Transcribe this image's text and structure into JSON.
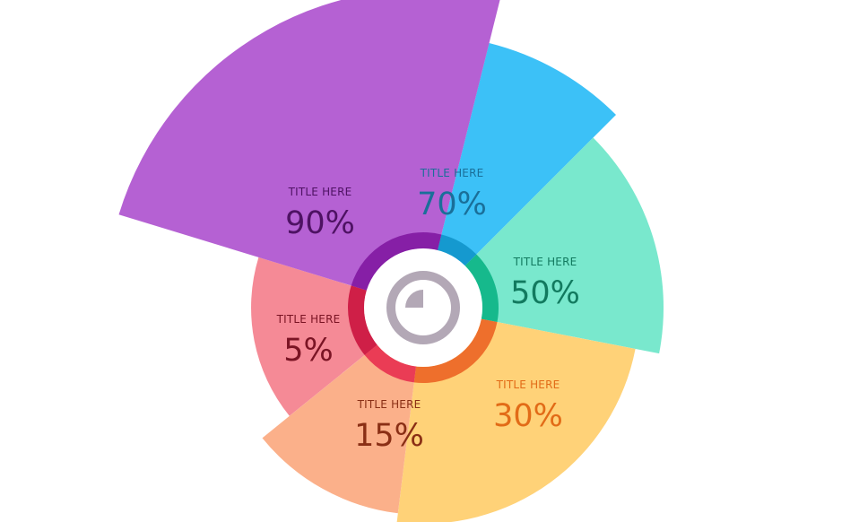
{
  "chart_data": {
    "type": "polar-area",
    "segments": [
      {
        "title": "TITLE HERE",
        "label": "70%",
        "value": 70,
        "color": "#3cc1f7",
        "ring_color": "#1599cf",
        "text_color": "#1a6f99"
      },
      {
        "title": "TITLE HERE",
        "label": "50%",
        "value": 50,
        "color": "#79e8cd",
        "ring_color": "#16b98c",
        "text_color": "#127a5f"
      },
      {
        "title": "TITLE HERE",
        "label": "30%",
        "value": 30,
        "color": "#ffd278",
        "ring_color": "#ee6f2c",
        "text_color": "#e26b17"
      },
      {
        "title": "TITLE HERE",
        "label": "15%",
        "value": 15,
        "color": "#fbb08a",
        "ring_color": "#ea3c55",
        "text_color": "#8a2f15"
      },
      {
        "title": "TITLE HERE",
        "label": "5%",
        "value": 5,
        "color": "#f58a96",
        "ring_color": "#cf1f47",
        "text_color": "#7a1424"
      },
      {
        "title": "TITLE HERE",
        "label": "90%",
        "value": 90,
        "color": "#b561d3",
        "ring_color": "#861fa6",
        "text_color": "#4e1263"
      }
    ],
    "center_icon": "pie-chart-icon",
    "icon_color": "#b3a8b6"
  }
}
